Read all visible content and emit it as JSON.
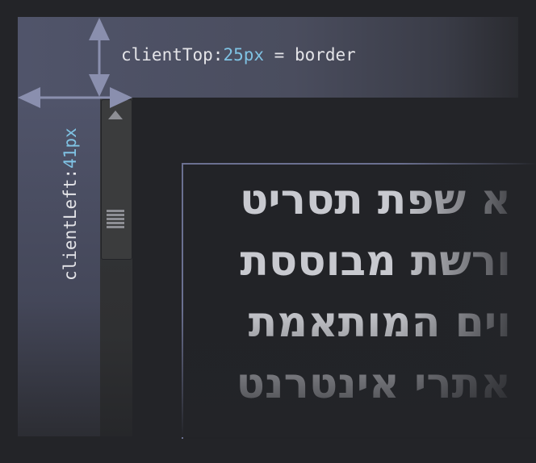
{
  "labels": {
    "client_top_name": "clientTop:",
    "client_top_value": "25px",
    "client_top_suffix": " = border",
    "client_left_name": "clientLeft:",
    "client_left_value": "41px"
  },
  "content": {
    "lines": [
      "א שפת תסריט",
      "ורשת מבוססת",
      "וים המותאמת",
      "אתרי אינטרנט"
    ]
  },
  "colors": {
    "border_band": "#50546a",
    "background": "#232428",
    "arrow": "#8a8fae",
    "value_highlight": "#7fc2e3",
    "label_text": "#e4e4e8"
  },
  "icons": {
    "scroll_up": "triangle-up-icon",
    "scroll_grip": "grip-lines-icon"
  }
}
